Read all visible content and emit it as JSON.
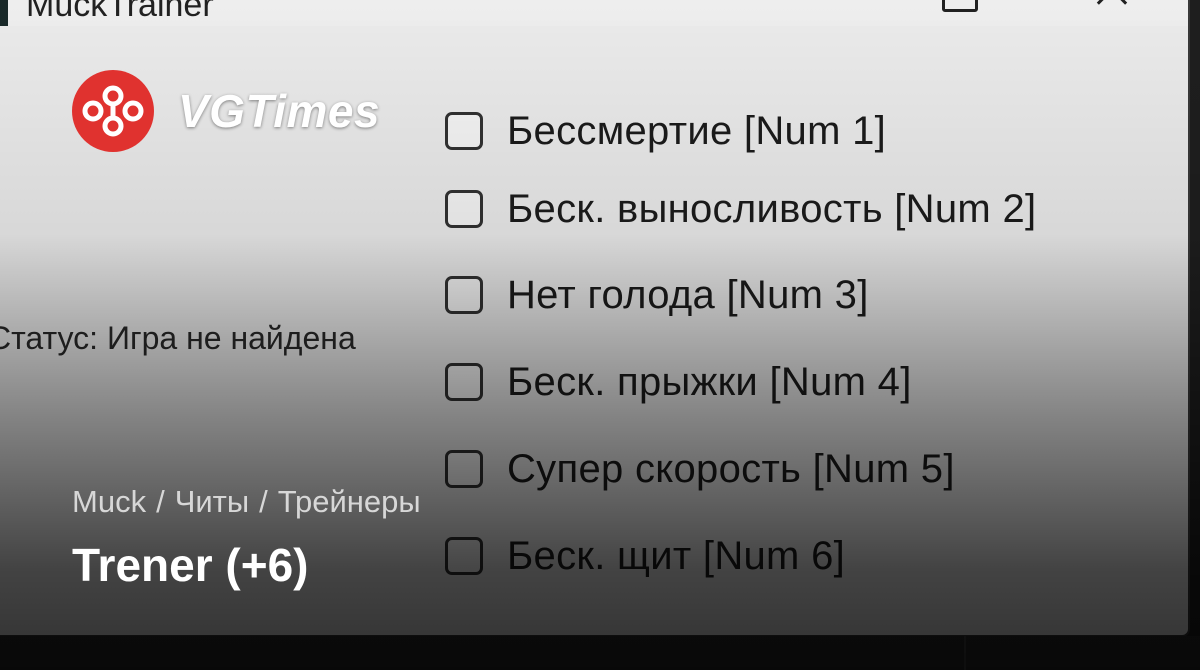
{
  "window": {
    "title": "MuckTrainer"
  },
  "trainer": {
    "status": "Статус: Игра не найдена",
    "cheats": [
      {
        "label": "Бессмертие [Num 1]",
        "checked": false
      },
      {
        "label": "Беск. выносливость [Num 2]",
        "checked": false
      },
      {
        "label": "Нет голода [Num 3]",
        "checked": false
      },
      {
        "label": "Беск. прыжки [Num 4]",
        "checked": false
      },
      {
        "label": "Супер скорость [Num 5]",
        "checked": false
      },
      {
        "label": "Беск. щит [Num 6]",
        "checked": false
      }
    ]
  },
  "branding": {
    "site_name": "VGTimes",
    "logo_icon": "vgtimes-logo-icon",
    "accent_color": "#e0322f"
  },
  "breadcrumb": [
    "Muck",
    "Читы",
    "Трейнеры"
  ],
  "breadcrumb_separator": "/",
  "page": {
    "title": "Trener (+6)"
  }
}
